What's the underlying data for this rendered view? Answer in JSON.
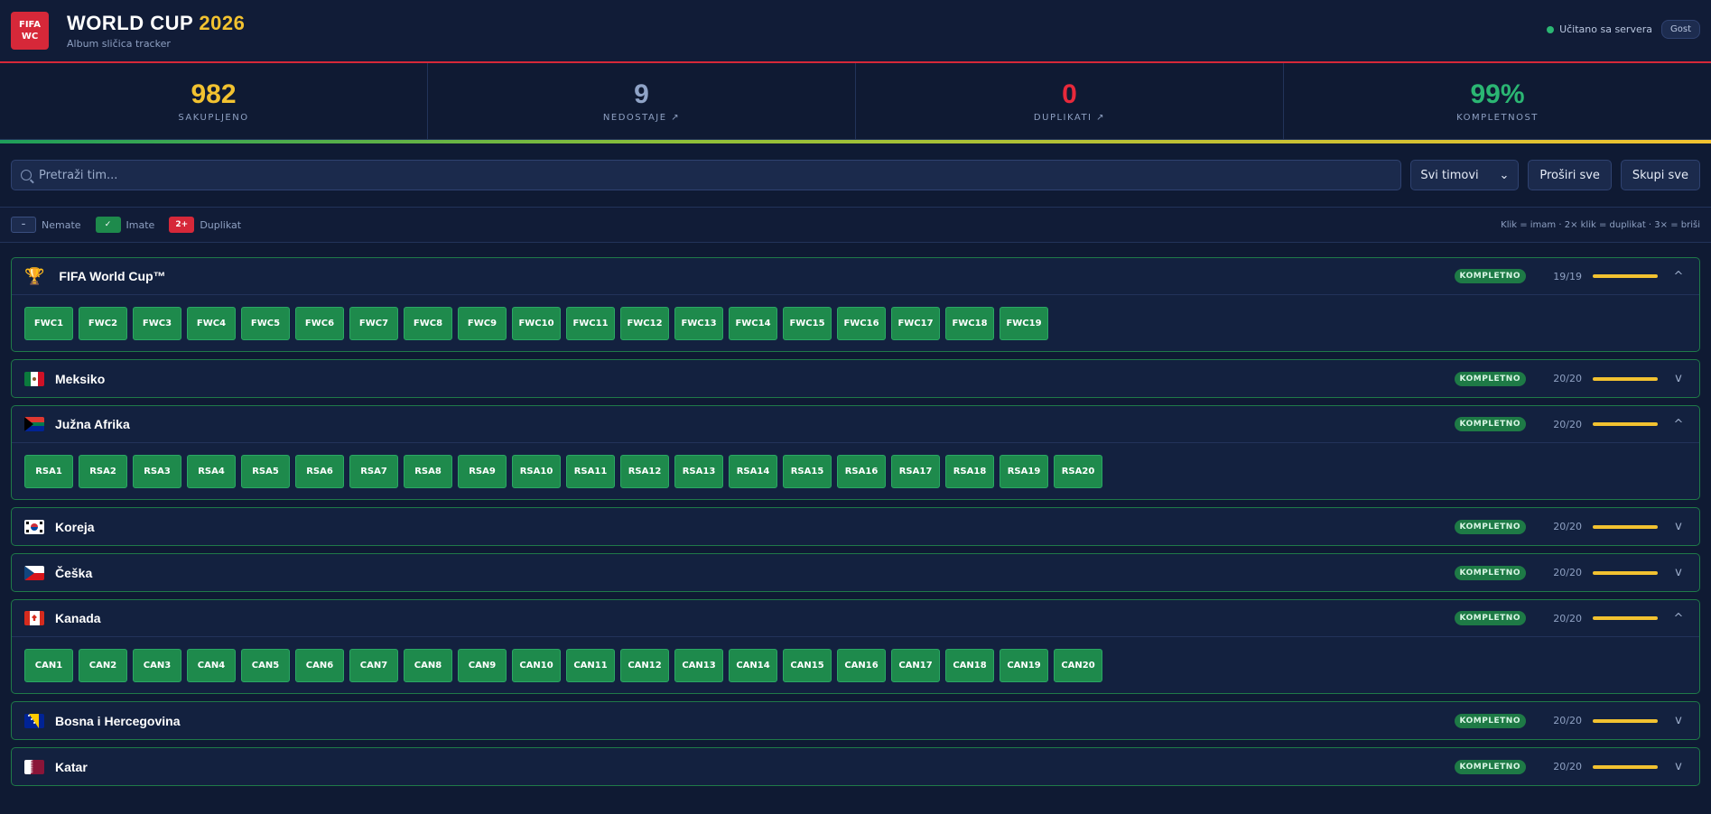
{
  "header": {
    "logo_line1": "FIFA",
    "logo_line2": "WC",
    "title_main": "WORLD CUP",
    "title_year": "2026",
    "subtitle": "Album sličica tracker",
    "server_status": "Učitano sa servera",
    "guest_label": "Gost"
  },
  "stats": [
    {
      "value": "982",
      "label": "SAKUPLJENO",
      "color": "#f2c230"
    },
    {
      "value": "9",
      "label": "NEDOSTAJE ↗",
      "color": "#8fa3c7"
    },
    {
      "value": "0",
      "label": "DUPLIKATI ↗",
      "color": "#e8293b"
    },
    {
      "value": "99%",
      "label": "KOMPLETNOST",
      "color": "#2bb673"
    }
  ],
  "toolbar": {
    "search_placeholder": "Pretraži tim...",
    "filter_value": "Svi timovi",
    "expand_label": "Proširi sve",
    "collapse_label": "Skupi sve"
  },
  "legend": {
    "none_symbol": "–",
    "none_label": "Nemate",
    "have_symbol": "✓",
    "have_label": "Imate",
    "dup_symbol": "2+",
    "dup_label": "Duplikat",
    "hint": "Klik = imam · 2× klik = duplikat · 3× = briši"
  },
  "teams": [
    {
      "name": "FIFA World Cup™",
      "icon": "trophy-icon",
      "status": "KOMPLETNO",
      "count": "19/19",
      "open": true,
      "chev": "^",
      "stickers": [
        "FWC1",
        "FWC2",
        "FWC3",
        "FWC4",
        "FWC5",
        "FWC6",
        "FWC7",
        "FWC8",
        "FWC9",
        "FWC10",
        "FWC11",
        "FWC12",
        "FWC13",
        "FWC14",
        "FWC15",
        "FWC16",
        "FWC17",
        "FWC18",
        "FWC19"
      ]
    },
    {
      "name": "Meksiko",
      "icon": "mexico-flag-icon",
      "status": "KOMPLETNO",
      "count": "20/20",
      "open": false,
      "chev": "v",
      "stickers": []
    },
    {
      "name": "Južna Afrika",
      "icon": "south-africa-flag-icon",
      "status": "KOMPLETNO",
      "count": "20/20",
      "open": true,
      "chev": "^",
      "stickers": [
        "RSA1",
        "RSA2",
        "RSA3",
        "RSA4",
        "RSA5",
        "RSA6",
        "RSA7",
        "RSA8",
        "RSA9",
        "RSA10",
        "RSA11",
        "RSA12",
        "RSA13",
        "RSA14",
        "RSA15",
        "RSA16",
        "RSA17",
        "RSA18",
        "RSA19",
        "RSA20"
      ]
    },
    {
      "name": "Koreja",
      "icon": "korea-flag-icon",
      "status": "KOMPLETNO",
      "count": "20/20",
      "open": false,
      "chev": "v",
      "stickers": []
    },
    {
      "name": "Češka",
      "icon": "czech-flag-icon",
      "status": "KOMPLETNO",
      "count": "20/20",
      "open": false,
      "chev": "v",
      "stickers": []
    },
    {
      "name": "Kanada",
      "icon": "canada-flag-icon",
      "status": "KOMPLETNO",
      "count": "20/20",
      "open": true,
      "chev": "^",
      "stickers": [
        "CAN1",
        "CAN2",
        "CAN3",
        "CAN4",
        "CAN5",
        "CAN6",
        "CAN7",
        "CAN8",
        "CAN9",
        "CAN10",
        "CAN11",
        "CAN12",
        "CAN13",
        "CAN14",
        "CAN15",
        "CAN16",
        "CAN17",
        "CAN18",
        "CAN19",
        "CAN20"
      ]
    },
    {
      "name": "Bosna i Hercegovina",
      "icon": "bosnia-flag-icon",
      "status": "KOMPLETNO",
      "count": "20/20",
      "open": false,
      "chev": "v",
      "stickers": []
    },
    {
      "name": "Katar",
      "icon": "qatar-flag-icon",
      "status": "KOMPLETNO",
      "count": "20/20",
      "open": false,
      "chev": "v",
      "stickers": []
    }
  ]
}
